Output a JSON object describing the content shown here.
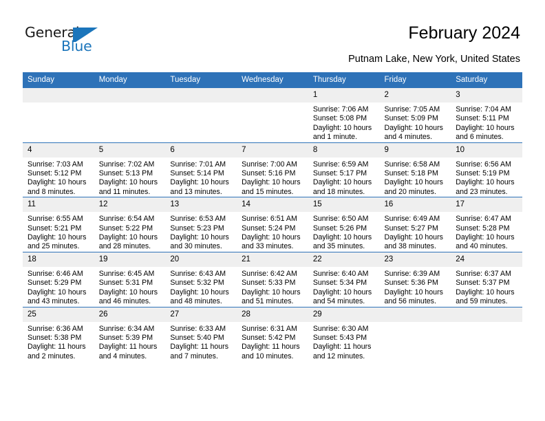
{
  "brand": {
    "name_line1": "General",
    "name_line2": "Blue",
    "logo_icon": "triangle-flag-icon",
    "accent_color": "#1b75bb"
  },
  "header": {
    "title": "February 2024",
    "subtitle": "Putnam Lake, New York, United States"
  },
  "calendar": {
    "header_color": "#2e72b8",
    "daynum_band_color": "#efefef",
    "weekday_headers": [
      "Sunday",
      "Monday",
      "Tuesday",
      "Wednesday",
      "Thursday",
      "Friday",
      "Saturday"
    ],
    "weeks": [
      [
        {
          "day": "",
          "lines": []
        },
        {
          "day": "",
          "lines": []
        },
        {
          "day": "",
          "lines": []
        },
        {
          "day": "",
          "lines": []
        },
        {
          "day": "1",
          "lines": [
            "Sunrise: 7:06 AM",
            "Sunset: 5:08 PM",
            "Daylight: 10 hours",
            "and 1 minute."
          ]
        },
        {
          "day": "2",
          "lines": [
            "Sunrise: 7:05 AM",
            "Sunset: 5:09 PM",
            "Daylight: 10 hours",
            "and 4 minutes."
          ]
        },
        {
          "day": "3",
          "lines": [
            "Sunrise: 7:04 AM",
            "Sunset: 5:11 PM",
            "Daylight: 10 hours",
            "and 6 minutes."
          ]
        }
      ],
      [
        {
          "day": "4",
          "lines": [
            "Sunrise: 7:03 AM",
            "Sunset: 5:12 PM",
            "Daylight: 10 hours",
            "and 8 minutes."
          ]
        },
        {
          "day": "5",
          "lines": [
            "Sunrise: 7:02 AM",
            "Sunset: 5:13 PM",
            "Daylight: 10 hours",
            "and 11 minutes."
          ]
        },
        {
          "day": "6",
          "lines": [
            "Sunrise: 7:01 AM",
            "Sunset: 5:14 PM",
            "Daylight: 10 hours",
            "and 13 minutes."
          ]
        },
        {
          "day": "7",
          "lines": [
            "Sunrise: 7:00 AM",
            "Sunset: 5:16 PM",
            "Daylight: 10 hours",
            "and 15 minutes."
          ]
        },
        {
          "day": "8",
          "lines": [
            "Sunrise: 6:59 AM",
            "Sunset: 5:17 PM",
            "Daylight: 10 hours",
            "and 18 minutes."
          ]
        },
        {
          "day": "9",
          "lines": [
            "Sunrise: 6:58 AM",
            "Sunset: 5:18 PM",
            "Daylight: 10 hours",
            "and 20 minutes."
          ]
        },
        {
          "day": "10",
          "lines": [
            "Sunrise: 6:56 AM",
            "Sunset: 5:19 PM",
            "Daylight: 10 hours",
            "and 23 minutes."
          ]
        }
      ],
      [
        {
          "day": "11",
          "lines": [
            "Sunrise: 6:55 AM",
            "Sunset: 5:21 PM",
            "Daylight: 10 hours",
            "and 25 minutes."
          ]
        },
        {
          "day": "12",
          "lines": [
            "Sunrise: 6:54 AM",
            "Sunset: 5:22 PM",
            "Daylight: 10 hours",
            "and 28 minutes."
          ]
        },
        {
          "day": "13",
          "lines": [
            "Sunrise: 6:53 AM",
            "Sunset: 5:23 PM",
            "Daylight: 10 hours",
            "and 30 minutes."
          ]
        },
        {
          "day": "14",
          "lines": [
            "Sunrise: 6:51 AM",
            "Sunset: 5:24 PM",
            "Daylight: 10 hours",
            "and 33 minutes."
          ]
        },
        {
          "day": "15",
          "lines": [
            "Sunrise: 6:50 AM",
            "Sunset: 5:26 PM",
            "Daylight: 10 hours",
            "and 35 minutes."
          ]
        },
        {
          "day": "16",
          "lines": [
            "Sunrise: 6:49 AM",
            "Sunset: 5:27 PM",
            "Daylight: 10 hours",
            "and 38 minutes."
          ]
        },
        {
          "day": "17",
          "lines": [
            "Sunrise: 6:47 AM",
            "Sunset: 5:28 PM",
            "Daylight: 10 hours",
            "and 40 minutes."
          ]
        }
      ],
      [
        {
          "day": "18",
          "lines": [
            "Sunrise: 6:46 AM",
            "Sunset: 5:29 PM",
            "Daylight: 10 hours",
            "and 43 minutes."
          ]
        },
        {
          "day": "19",
          "lines": [
            "Sunrise: 6:45 AM",
            "Sunset: 5:31 PM",
            "Daylight: 10 hours",
            "and 46 minutes."
          ]
        },
        {
          "day": "20",
          "lines": [
            "Sunrise: 6:43 AM",
            "Sunset: 5:32 PM",
            "Daylight: 10 hours",
            "and 48 minutes."
          ]
        },
        {
          "day": "21",
          "lines": [
            "Sunrise: 6:42 AM",
            "Sunset: 5:33 PM",
            "Daylight: 10 hours",
            "and 51 minutes."
          ]
        },
        {
          "day": "22",
          "lines": [
            "Sunrise: 6:40 AM",
            "Sunset: 5:34 PM",
            "Daylight: 10 hours",
            "and 54 minutes."
          ]
        },
        {
          "day": "23",
          "lines": [
            "Sunrise: 6:39 AM",
            "Sunset: 5:36 PM",
            "Daylight: 10 hours",
            "and 56 minutes."
          ]
        },
        {
          "day": "24",
          "lines": [
            "Sunrise: 6:37 AM",
            "Sunset: 5:37 PM",
            "Daylight: 10 hours",
            "and 59 minutes."
          ]
        }
      ],
      [
        {
          "day": "25",
          "lines": [
            "Sunrise: 6:36 AM",
            "Sunset: 5:38 PM",
            "Daylight: 11 hours",
            "and 2 minutes."
          ]
        },
        {
          "day": "26",
          "lines": [
            "Sunrise: 6:34 AM",
            "Sunset: 5:39 PM",
            "Daylight: 11 hours",
            "and 4 minutes."
          ]
        },
        {
          "day": "27",
          "lines": [
            "Sunrise: 6:33 AM",
            "Sunset: 5:40 PM",
            "Daylight: 11 hours",
            "and 7 minutes."
          ]
        },
        {
          "day": "28",
          "lines": [
            "Sunrise: 6:31 AM",
            "Sunset: 5:42 PM",
            "Daylight: 11 hours",
            "and 10 minutes."
          ]
        },
        {
          "day": "29",
          "lines": [
            "Sunrise: 6:30 AM",
            "Sunset: 5:43 PM",
            "Daylight: 11 hours",
            "and 12 minutes."
          ]
        },
        {
          "day": "",
          "lines": []
        },
        {
          "day": "",
          "lines": []
        }
      ]
    ]
  }
}
